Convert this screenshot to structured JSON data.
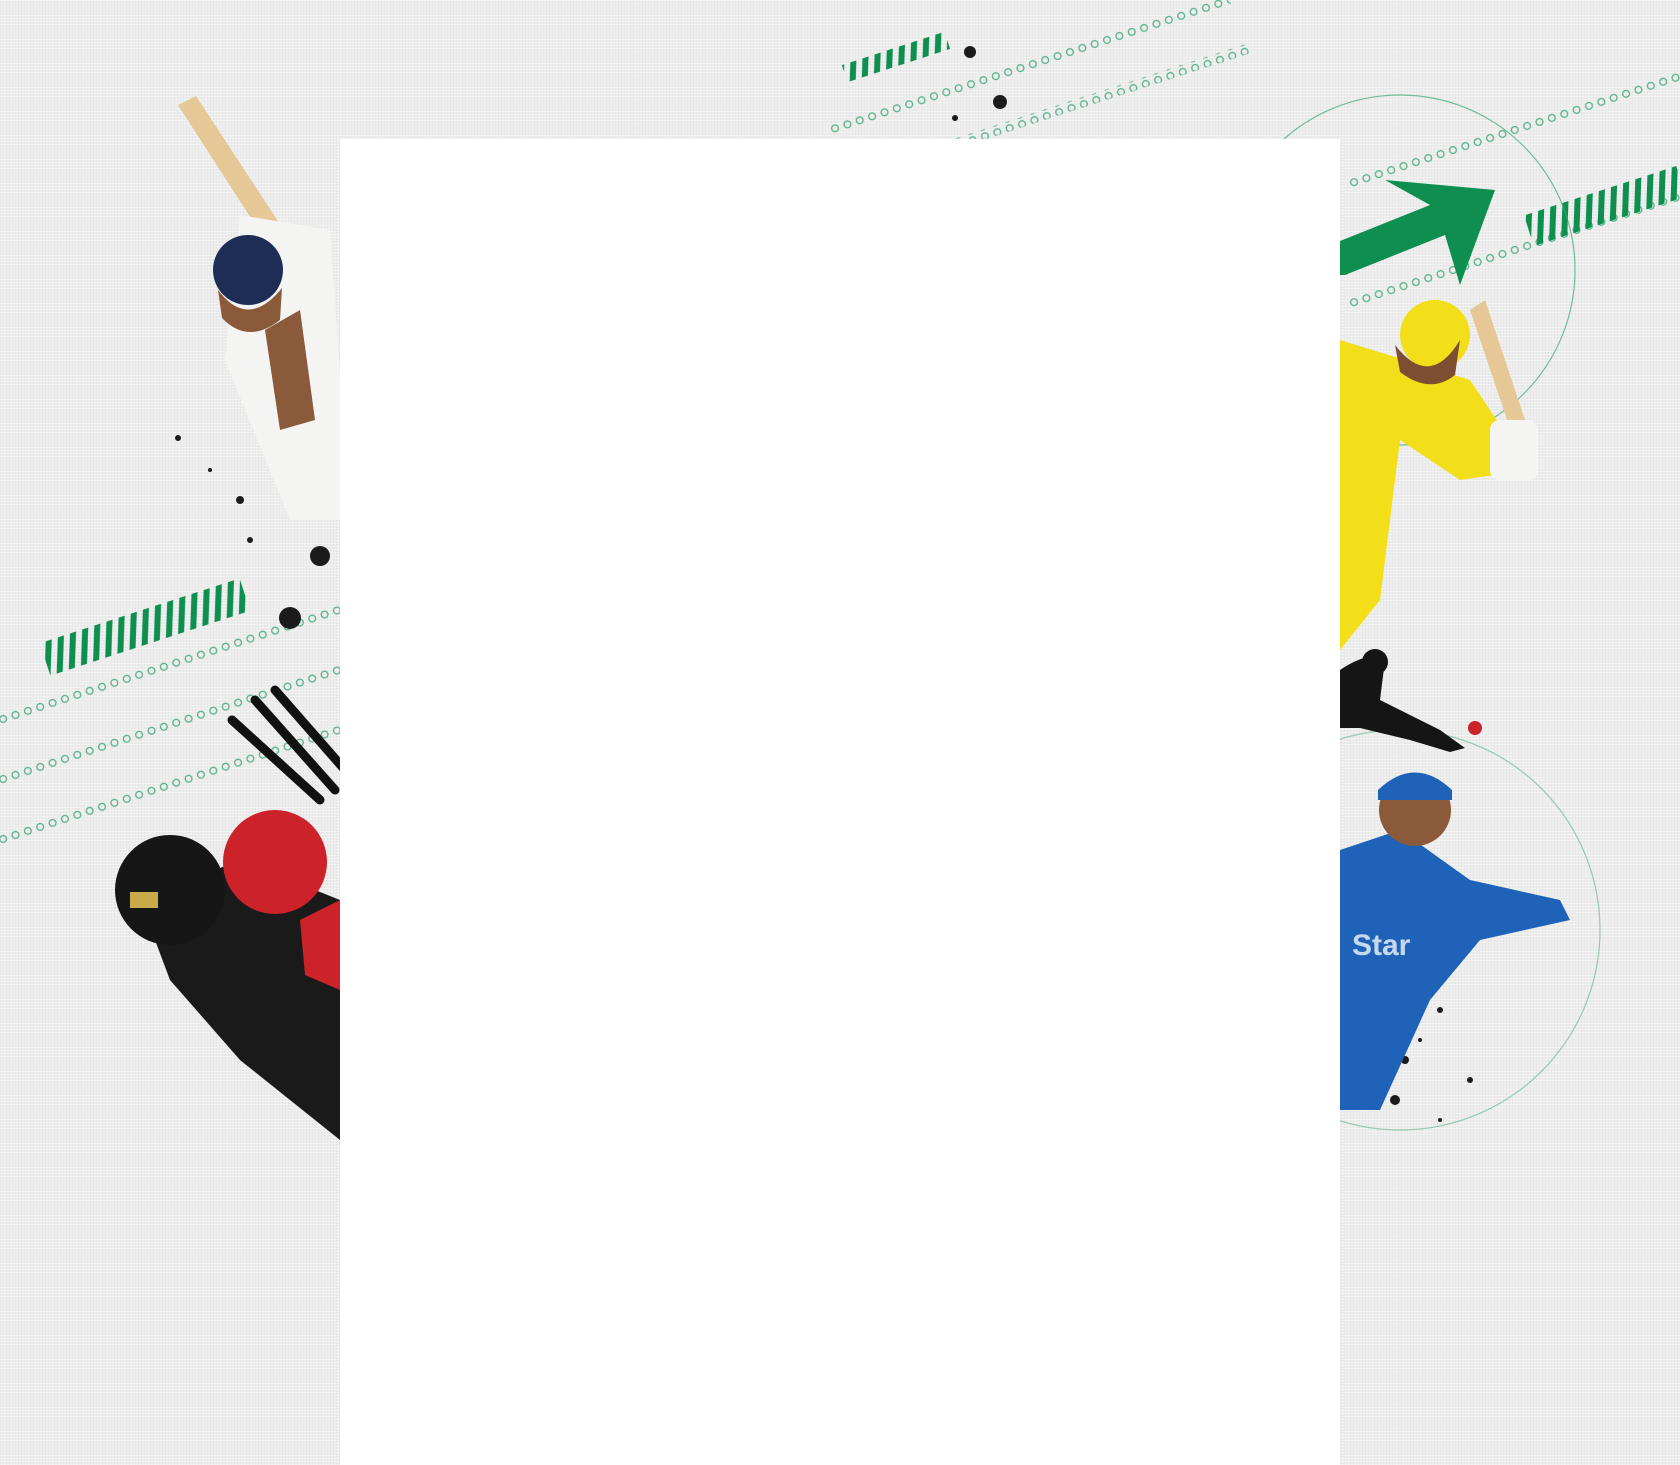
{
  "page": {
    "background_color": "#ececec",
    "panel_color": "#ffffff",
    "accent_color": "#0e8f4f",
    "jersey_yellow": "#f2df1a",
    "jersey_blue": "#1f63b8",
    "helmet_red": "#cc2229",
    "helmet_navy": "#1d2d55",
    "main_panel_text": ""
  },
  "decorations": [
    "batsman-left-top",
    "keeper-left-bottom",
    "batsman-right-yellow",
    "fielder-silhouette-right",
    "fielder-right-blue",
    "green-arrow-icon",
    "green-stripes",
    "dotted-chain-lines",
    "ink-splatter"
  ]
}
